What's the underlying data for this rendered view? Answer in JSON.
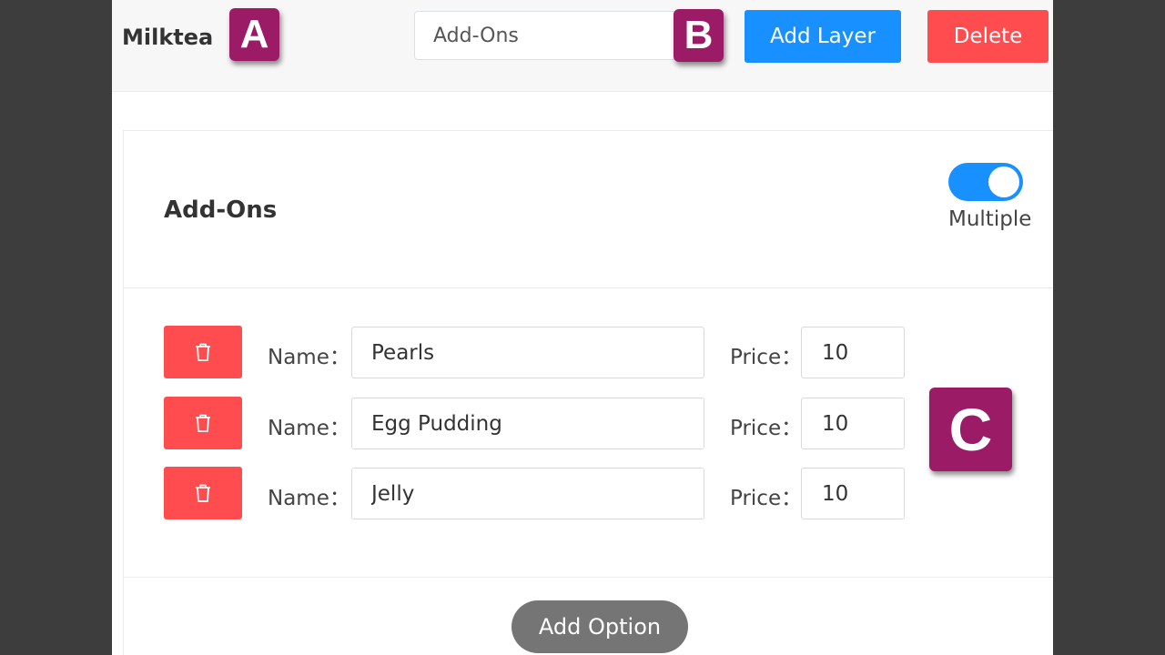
{
  "header": {
    "product_name": "Milktea",
    "layer_input_value": "Add-Ons",
    "add_layer_label": "Add Layer",
    "delete_label": "Delete"
  },
  "card": {
    "title": "Add-Ons",
    "multiple_label": "Multiple",
    "multiple_enabled": true,
    "name_label": "Name：",
    "price_label": "Price：",
    "options": [
      {
        "name": "Pearls",
        "price": "10"
      },
      {
        "name": "Egg Pudding",
        "price": "10"
      },
      {
        "name": "Jelly",
        "price": "10"
      }
    ],
    "add_option_label": "Add Option"
  },
  "callouts": {
    "a": "A",
    "b": "B",
    "c": "C"
  },
  "colors": {
    "primary": "#1890ff",
    "danger": "#ff4d4f",
    "callout": "#9b1b66",
    "neutral_button": "#757575"
  },
  "icons": {
    "delete_option": "trash-icon"
  }
}
